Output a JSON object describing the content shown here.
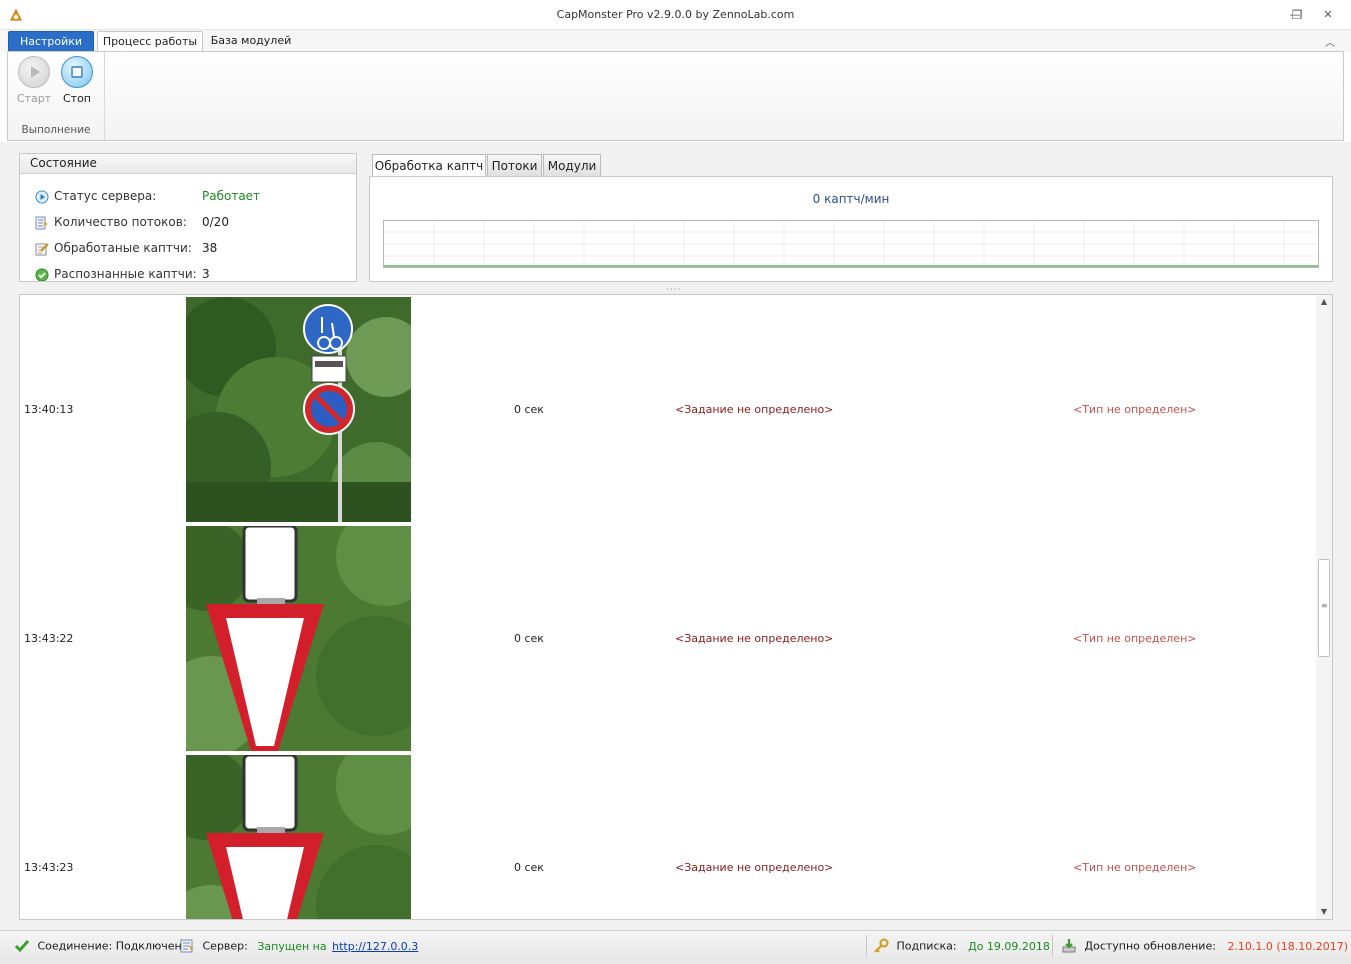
{
  "window": {
    "title": "CapMonster Pro v2.9.0.0 by ZennoLab.com",
    "minimize_glyph": "—",
    "restore_glyph": "❐",
    "close_glyph": "✕"
  },
  "ribbon_tabs": {
    "file": "Настройки",
    "tabs": [
      "Процесс работы",
      "База модулей"
    ],
    "active": "Процесс работы",
    "collapse_glyph": "︿"
  },
  "ribbon": {
    "group_caption": "Выполнение",
    "start_label": "Старт",
    "stop_label": "Стоп",
    "start_enabled": false
  },
  "state_panel": {
    "title": "Состояние",
    "rows": [
      {
        "icon": "play-status-icon",
        "label": "Статус сервера:",
        "value": "Работает",
        "value_color": "#1c8a23"
      },
      {
        "icon": "threads-icon",
        "label": "Количество потоков:",
        "value": "0/20"
      },
      {
        "icon": "processed-icon",
        "label": "Обработаные каптчи:",
        "value": "38"
      },
      {
        "icon": "recognized-icon",
        "label": "Распознанные каптчи:",
        "value": "3"
      }
    ]
  },
  "stats_tabs": {
    "tabs": [
      "Обработка каптч",
      "Потоки",
      "Модули"
    ],
    "active": "Обработка каптч",
    "rate_caption": "0 каптч/мин"
  },
  "log": {
    "rows": [
      {
        "time": "13:40:13",
        "image": "parking-sign-image",
        "duration": "0 сек",
        "task": "<Задание не определено>",
        "type": "<Тип не определен>"
      },
      {
        "time": "13:43:22",
        "image": "yield-sign-image",
        "duration": "0 сек",
        "task": "<Задание не определено>",
        "type": "<Тип не определен>"
      },
      {
        "time": "13:43:23",
        "image": "yield-sign-image",
        "duration": "0 сек",
        "task": "<Задание не определено>",
        "type": "<Тип не определен>"
      }
    ]
  },
  "statusbar": {
    "connection": "Соединение: Подключено",
    "server_label": "Сервер:",
    "server_status": "Запущен на",
    "server_url": "http://127.0.0.3",
    "subscription_label": "Подписка:",
    "subscription_value": "До 19.09.2018",
    "update_label": "Доступно обновление:",
    "update_value": "2.10.1.0 (18.10.2017)"
  },
  "colors": {
    "accent": "#2b6ec7",
    "ok_green": "#1c8a23",
    "task_red": "#8b1c1c",
    "type_red": "#c0504d",
    "update_orange": "#e0451b"
  }
}
